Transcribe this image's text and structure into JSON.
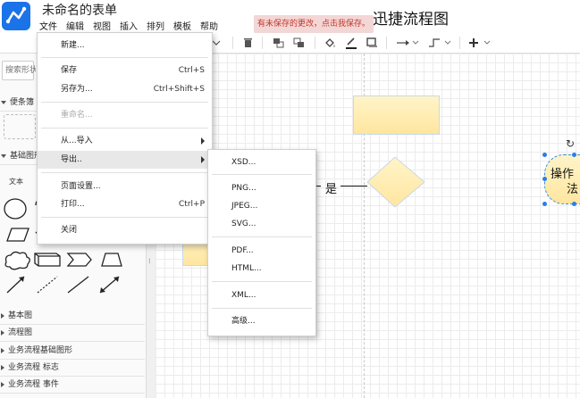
{
  "header": {
    "doc_title": "未命名的表单",
    "app_title": "迅捷流程图",
    "unsaved_notice": "有未保存的更改，点击我保存。"
  },
  "menubar": [
    "文件",
    "编辑",
    "视图",
    "插入",
    "排列",
    "模板",
    "帮助"
  ],
  "sidebar": {
    "search_placeholder": "搜索形状",
    "sections_top": [
      "便条簿",
      "基础图形"
    ],
    "text_shape_label": "文本",
    "sections_bottom": [
      "基本图",
      "流程图",
      "业务流程基础图形",
      "业务流程 标志",
      "业务流程 事件"
    ]
  },
  "file_menu": {
    "items": [
      {
        "label": "新建...",
        "shortcut": "",
        "submenu": false,
        "disabled": false
      },
      {
        "label": "保存",
        "shortcut": "Ctrl+S",
        "submenu": false,
        "disabled": false
      },
      {
        "label": "另存为...",
        "shortcut": "Ctrl+Shift+S",
        "submenu": false,
        "disabled": false
      },
      {
        "label": "重命名...",
        "shortcut": "",
        "submenu": false,
        "disabled": true
      },
      {
        "label": "从...导入",
        "shortcut": "",
        "submenu": true,
        "disabled": false
      },
      {
        "label": "导出..",
        "shortcut": "",
        "submenu": true,
        "disabled": false,
        "highlighted": true
      },
      {
        "label": "页面设置...",
        "shortcut": "",
        "submenu": false,
        "disabled": false
      },
      {
        "label": "打印...",
        "shortcut": "Ctrl+P",
        "submenu": false,
        "disabled": false
      },
      {
        "label": "关闭",
        "shortcut": "",
        "submenu": false,
        "disabled": false
      }
    ]
  },
  "export_menu": {
    "items": [
      "XSD...",
      "PNG...",
      "JPEG...",
      "SVG...",
      "PDF...",
      "HTML...",
      "XML...",
      "高级..."
    ]
  },
  "canvas": {
    "edge_label": "是",
    "selected_shape_text_line1": "操作",
    "selected_shape_text_line2": "法"
  },
  "colors": {
    "accent": "#1a73e8",
    "shape_fill_top": "#fff4c8",
    "shape_fill_bottom": "#ffe6a0",
    "selection": "#2b7de9",
    "unsaved_bg": "#f3d6d6",
    "unsaved_text": "#c0392b"
  }
}
